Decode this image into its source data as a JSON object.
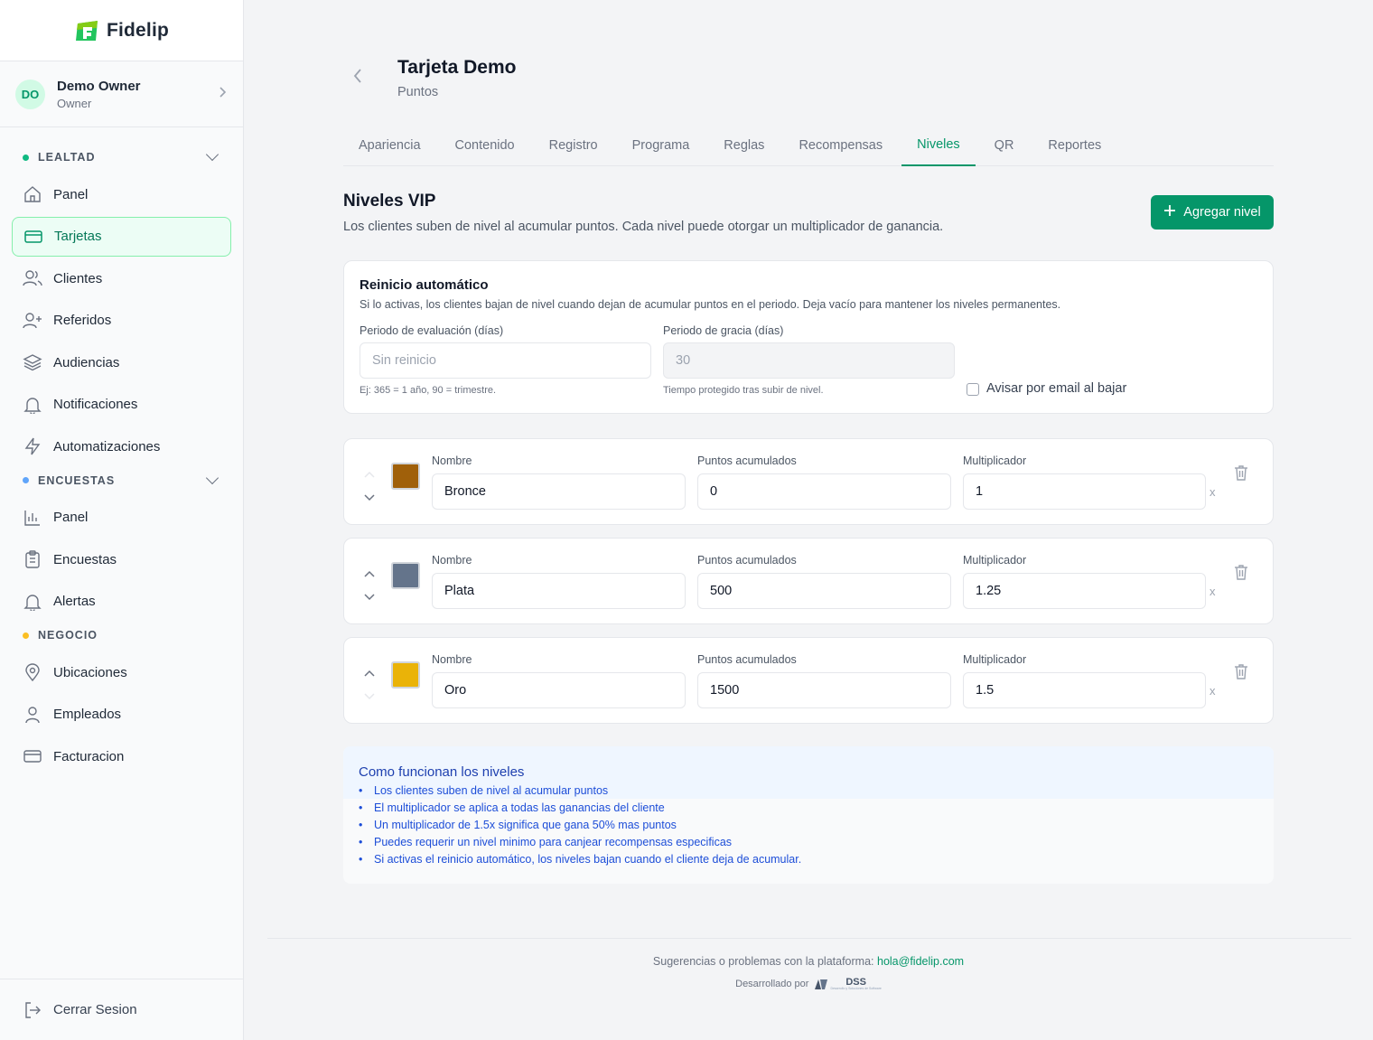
{
  "app": {
    "brand": "Fidelip",
    "brand_color": "#059669"
  },
  "user": {
    "initials": "DO",
    "name": "Demo Owner",
    "role": "Owner"
  },
  "sidebar": {
    "sections": [
      {
        "title": "LEALTAD",
        "dot_color": "#10b981",
        "items": [
          {
            "label": "Panel",
            "icon": "home-icon"
          },
          {
            "label": "Tarjetas",
            "icon": "card-icon",
            "active": true
          },
          {
            "label": "Clientes",
            "icon": "users-icon"
          },
          {
            "label": "Referidos",
            "icon": "user-plus-icon"
          },
          {
            "label": "Audiencias",
            "icon": "layers-icon"
          },
          {
            "label": "Notificaciones",
            "icon": "bell-icon"
          },
          {
            "label": "Automatizaciones",
            "icon": "bolt-icon"
          }
        ]
      },
      {
        "title": "ENCUESTAS",
        "dot_color": "#60a5fa",
        "items": [
          {
            "label": "Panel",
            "icon": "bar-chart-icon"
          },
          {
            "label": "Encuestas",
            "icon": "clipboard-icon"
          },
          {
            "label": "Alertas",
            "icon": "bell-icon"
          }
        ]
      },
      {
        "title": "NEGOCIO",
        "dot_color": "#fbbf24",
        "items": [
          {
            "label": "Ubicaciones",
            "icon": "map-pin-icon"
          },
          {
            "label": "Empleados",
            "icon": "user-icon"
          },
          {
            "label": "Facturacion",
            "icon": "credit-card-icon"
          }
        ]
      }
    ],
    "logout": "Cerrar Sesion"
  },
  "page": {
    "title": "Tarjeta Demo",
    "subtitle": "Puntos"
  },
  "tabs": [
    "Apariencia",
    "Contenido",
    "Registro",
    "Programa",
    "Reglas",
    "Recompensas",
    "Niveles",
    "QR",
    "Reportes"
  ],
  "active_tab": "Niveles",
  "section": {
    "title": "Niveles VIP",
    "description": "Los clientes suben de nivel al acumular puntos. Cada nivel puede otorgar un multiplicador de ganancia.",
    "add_button": "Agregar nivel"
  },
  "reset": {
    "title": "Reinicio automático",
    "description": "Si lo activas, los clientes bajan de nivel cuando dejan de acumular puntos en el periodo. Deja vacío para mantener los niveles permanentes.",
    "eval_label": "Periodo de evaluación (días)",
    "eval_placeholder": "Sin reinicio",
    "eval_hint": "Ej: 365 = 1 año, 90 = trimestre.",
    "grace_label": "Periodo de gracia (días)",
    "grace_value": "30",
    "grace_hint": "Tiempo protegido tras subir de nivel.",
    "email_label": "Avisar por email al bajar",
    "email_checked": false
  },
  "level_labels": {
    "name": "Nombre",
    "points": "Puntos acumulados",
    "multiplier": "Multiplicador",
    "x": "x"
  },
  "levels": [
    {
      "name": "Bronce",
      "points": "0",
      "multiplier": "1",
      "color": "#a0600a"
    },
    {
      "name": "Plata",
      "points": "500",
      "multiplier": "1.25",
      "color": "#64748b"
    },
    {
      "name": "Oro",
      "points": "1500",
      "multiplier": "1.5",
      "color": "#eab308"
    }
  ],
  "info": {
    "title": "Como funcionan los niveles",
    "items": [
      "Los clientes suben de nivel al acumular puntos",
      "El multiplicador se aplica a todas las ganancias del cliente",
      "Un multiplicador de 1.5x significa que gana 50% mas puntos",
      "Puedes requerir un nivel minimo para canjear recompensas especificas",
      "Si activas el reinicio automático, los niveles bajan cuando el cliente deja de acumular."
    ]
  },
  "footer": {
    "text": "Sugerencias o problemas con la plataforma:",
    "email": "hola@fidelip.com",
    "dev_text": "Desarrollado por",
    "dev_logo": "DSS",
    "dev_logo_sub": "Desarrollo y Soluciones de Software"
  }
}
